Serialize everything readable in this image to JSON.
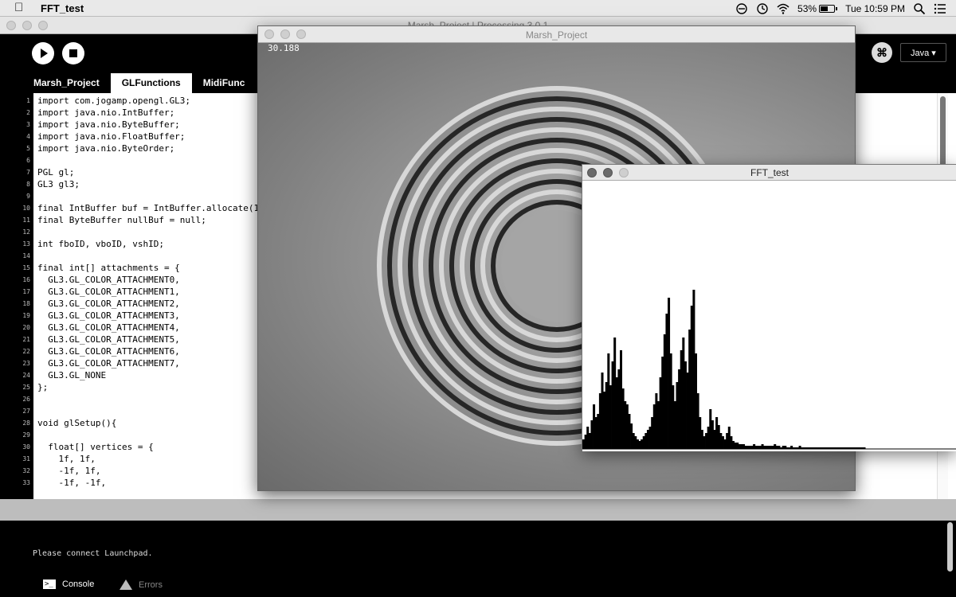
{
  "menubar": {
    "app_name": "FFT_test",
    "battery": "53%",
    "clock": "Tue 10:59 PM"
  },
  "pde_window": {
    "title": "Marsh_Project | Processing 3.0.1",
    "tabs": [
      "Marsh_Project",
      "GLFunctions",
      "MidiFunc"
    ],
    "active_tab": 1,
    "mode": "Java ▾",
    "debug_icon": "butterfly-icon"
  },
  "editor": {
    "lines": [
      "import com.jogamp.opengl.GL3;",
      "import java.nio.IntBuffer;",
      "import java.nio.ByteBuffer;",
      "import java.nio.FloatBuffer;",
      "import java.nio.ByteOrder;",
      "",
      "PGL gl;",
      "GL3 gl3;",
      "",
      "final IntBuffer buf = IntBuffer.allocate(1",
      "final ByteBuffer nullBuf = null;",
      "",
      "int fboID, vboID, vshID;",
      "",
      "final int[] attachments = {",
      "  GL3.GL_COLOR_ATTACHMENT0,",
      "  GL3.GL_COLOR_ATTACHMENT1,",
      "  GL3.GL_COLOR_ATTACHMENT2,",
      "  GL3.GL_COLOR_ATTACHMENT3,",
      "  GL3.GL_COLOR_ATTACHMENT4,",
      "  GL3.GL_COLOR_ATTACHMENT5,",
      "  GL3.GL_COLOR_ATTACHMENT6,",
      "  GL3.GL_COLOR_ATTACHMENT7,",
      "  GL3.GL_NONE",
      "};",
      "",
      "",
      "void glSetup(){",
      "",
      "  float[] vertices = {",
      "    1f, 1f,",
      "    -1f, 1f,",
      "    -1f, -1f,"
    ]
  },
  "console": {
    "message": "Please connect Launchpad.",
    "tabs": {
      "console": "Console",
      "errors": "Errors"
    }
  },
  "sketch_window": {
    "title": "Marsh_Project",
    "fps": "30.188"
  },
  "fft_window": {
    "title": "FFT_test",
    "spectrum": [
      0.06,
      0.09,
      0.14,
      0.1,
      0.18,
      0.28,
      0.2,
      0.22,
      0.35,
      0.48,
      0.36,
      0.42,
      0.6,
      0.4,
      0.55,
      0.7,
      0.45,
      0.5,
      0.62,
      0.38,
      0.3,
      0.28,
      0.22,
      0.16,
      0.1,
      0.08,
      0.06,
      0.05,
      0.06,
      0.08,
      0.1,
      0.12,
      0.14,
      0.2,
      0.28,
      0.35,
      0.3,
      0.45,
      0.58,
      0.72,
      0.85,
      0.95,
      0.6,
      0.4,
      0.3,
      0.42,
      0.5,
      0.62,
      0.7,
      0.55,
      0.48,
      0.75,
      0.9,
      1.0,
      0.6,
      0.35,
      0.2,
      0.12,
      0.08,
      0.1,
      0.14,
      0.25,
      0.18,
      0.12,
      0.2,
      0.15,
      0.1,
      0.08,
      0.06,
      0.1,
      0.14,
      0.08,
      0.05,
      0.04,
      0.04,
      0.03,
      0.03,
      0.03,
      0.02,
      0.02,
      0.02,
      0.02,
      0.03,
      0.02,
      0.02,
      0.02,
      0.03,
      0.02,
      0.02,
      0.02,
      0.02,
      0.02,
      0.03,
      0.02,
      0.02,
      0.01,
      0.02,
      0.02,
      0.01,
      0.01,
      0.02,
      0.01,
      0.01,
      0.01,
      0.02,
      0.01,
      0.01,
      0.01,
      0.01,
      0.01,
      0.01,
      0.01,
      0.01,
      0.01,
      0.01,
      0.01,
      0.01,
      0.01,
      0.01,
      0.01,
      0.01,
      0.01,
      0.01,
      0.01,
      0.01,
      0.01,
      0.01,
      0.01,
      0.01,
      0.01,
      0.01,
      0.01,
      0.01,
      0.01,
      0.01,
      0.01
    ]
  }
}
